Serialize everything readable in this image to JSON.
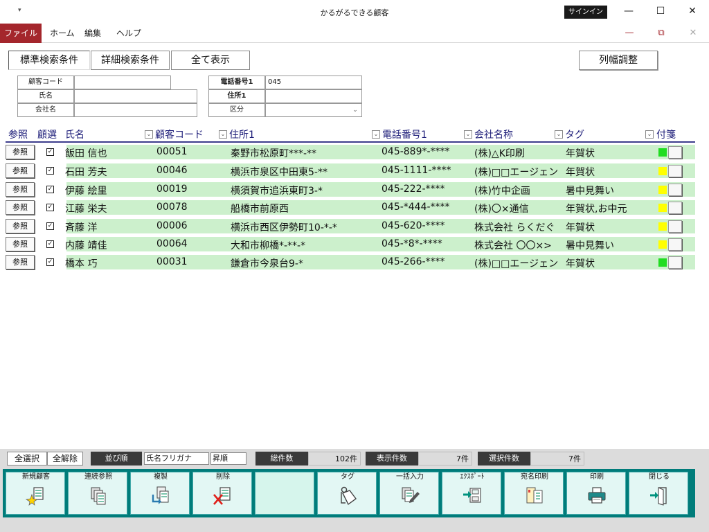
{
  "window": {
    "title": "かるがるできる顧客",
    "qa_glyph": "▾",
    "signin_label": "サインイン",
    "min_glyph": "—",
    "max_glyph": "☐",
    "close_glyph": "✕"
  },
  "menu": {
    "file": "ファイル",
    "home": "ホーム",
    "edit": "編集",
    "help": "ヘルプ",
    "doc_min": "—",
    "doc_restore": "⧉",
    "doc_close": "✕"
  },
  "toolbar": {
    "standard_search": "標準検索条件",
    "advanced_search": "詳細検索条件",
    "show_all": "全て表示",
    "column_width": "列幅調整"
  },
  "search": {
    "customer_code_label": "顧客コード",
    "customer_code_value": "",
    "name_label": "氏名",
    "name_value": "",
    "company_label": "会社名",
    "company_value": "",
    "phone_label": "電話番号1",
    "phone_value": "045",
    "address_label": "住所1",
    "address_value": "",
    "category_label": "区分",
    "category_value": "",
    "dropdown_glyph": "⌄"
  },
  "grid": {
    "headers": {
      "ref": "参照",
      "select": "顧選",
      "name": "氏名",
      "code": "顧客コード",
      "address": "住所1",
      "phone": "電話番号1",
      "company": "会社名称",
      "tag": "タグ",
      "note": "付箋"
    },
    "dd_glyph": "⌄",
    "ref_button_label": "参照",
    "check_glyph": "✓",
    "rows": [
      {
        "name": "飯田 信也",
        "code": "00051",
        "address": "秦野市松原町***-**",
        "phone": "045-889*-****",
        "company": "(株)△K印刷",
        "tag": "年賀状",
        "note_color": "#22dd22"
      },
      {
        "name": "石田 芳夫",
        "code": "00046",
        "address": "横浜市泉区中田東5-**",
        "phone": "045-1111-****",
        "company": "(株)□□エージェン",
        "tag": "年賀状",
        "note_color": "#ffff00"
      },
      {
        "name": "伊藤 絵里",
        "code": "00019",
        "address": "横須賀市追浜東町3-*",
        "phone": "045-222-****",
        "company": "(株)竹中企画",
        "tag": "暑中見舞い",
        "note_color": "#ffff00"
      },
      {
        "name": "江藤 栄夫",
        "code": "00078",
        "address": "船橋市前原西",
        "phone": "045-*444-****",
        "company": "(株)〇×通信",
        "tag": "年賀状,お中元",
        "note_color": "#ffff00"
      },
      {
        "name": "斉藤 洋",
        "code": "00006",
        "address": "横浜市西区伊勢町10-*-*",
        "phone": "045-620-****",
        "company": "株式会社 らくだぐ",
        "tag": "年賀状",
        "note_color": "#ffff00"
      },
      {
        "name": "内藤 靖佳",
        "code": "00064",
        "address": "大和市柳橋*-**-*",
        "phone": "045-*8*-****",
        "company": "株式会社 〇〇×>",
        "tag": "暑中見舞い",
        "note_color": "#ffff00"
      },
      {
        "name": "橋本 巧",
        "code": "00031",
        "address": "鎌倉市今泉台9-*",
        "phone": "045-266-****",
        "company": "(株)□□エージェン",
        "tag": "年賀状",
        "note_color": "#22dd22"
      }
    ]
  },
  "footer": {
    "select_all": "全選択",
    "deselect_all": "全解除",
    "sort_label": "並び順",
    "sort_field": "氏名フリガナ",
    "sort_order": "昇順",
    "total_label": "総件数",
    "total_value": "102件",
    "shown_label": "表示件数",
    "shown_value": "7件",
    "selected_label": "選択件数",
    "selected_value": "7件"
  },
  "actions": [
    {
      "label": "新規顧客",
      "icon": "new-customer-icon"
    },
    {
      "label": "連続参照",
      "icon": "continuous-view-icon"
    },
    {
      "label": "複製",
      "icon": "duplicate-icon"
    },
    {
      "label": "削除",
      "icon": "delete-icon"
    },
    {
      "label": "",
      "icon": ""
    },
    {
      "label": "タグ",
      "icon": "tag-icon"
    },
    {
      "label": "一括入力",
      "icon": "bulk-input-icon"
    },
    {
      "label": "ｴｸｽﾎﾟｰﾄ",
      "icon": "export-icon"
    },
    {
      "label": "宛名印刷",
      "icon": "address-print-icon"
    },
    {
      "label": "印刷",
      "icon": "printer-icon"
    },
    {
      "label": "閉じる",
      "icon": "close-door-icon"
    }
  ]
}
